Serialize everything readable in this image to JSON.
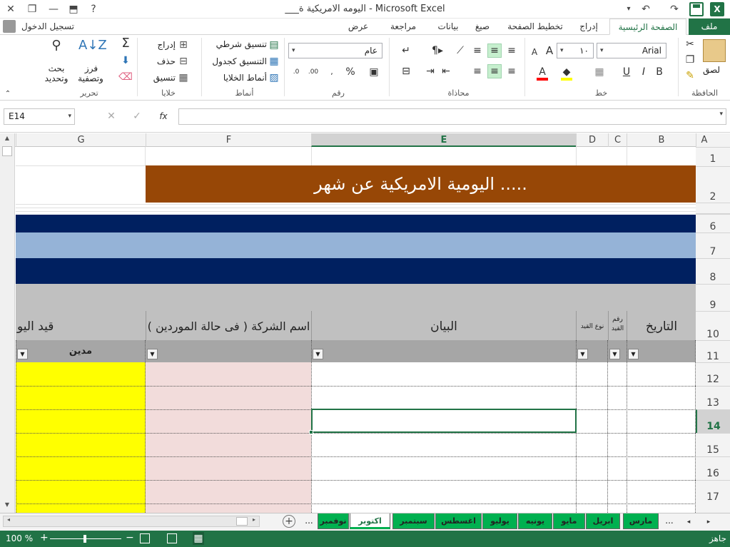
{
  "window": {
    "title": "___اليومه الامريكية ة - Microsoft Excel"
  },
  "tabs": {
    "file": "ملف",
    "home": "الصفحة الرئيسية",
    "insert": "إدراج",
    "page_layout": "تخطيط الصفحة",
    "formulas": "صيغ",
    "data": "بيانات",
    "review": "مراجعة",
    "view": "عرض"
  },
  "signin": {
    "label": "تسجيل الدخول"
  },
  "ribbon": {
    "clipboard": {
      "group": "الحافظة",
      "paste": "لصق"
    },
    "font": {
      "group": "خط",
      "name": "Arial",
      "size": "١٠",
      "bold": "B",
      "italic": "I",
      "underline": "U",
      "grow": "A",
      "shrink": "A"
    },
    "alignment": {
      "group": "محاذاة"
    },
    "number": {
      "group": "رقم",
      "format": "عام",
      "percent": "%"
    },
    "styles": {
      "group": "أنماط",
      "conditional": "تنسيق شرطي",
      "as_table": "التنسيق كجدول",
      "cell_styles": "أنماط الخلايا"
    },
    "cells": {
      "group": "خلايا",
      "insert": "إدراج",
      "delete": "حذف",
      "format": "تنسيق"
    },
    "editing": {
      "group": "تحرير",
      "sort": "فرز",
      "sort2": "وتصفية",
      "find": "بحث",
      "find2": "وتحديد"
    }
  },
  "formula_bar": {
    "name_box": "E14",
    "value": "",
    "fx": "fx"
  },
  "columns": [
    "A",
    "B",
    "C",
    "D",
    "E",
    "F",
    "G"
  ],
  "rows": [
    "1",
    "2",
    "6",
    "7",
    "8",
    "9",
    "10",
    "11",
    "12",
    "13",
    "14",
    "15",
    "16",
    "17"
  ],
  "sheet": {
    "title": "اليومية الامريكية عن شهر .....",
    "headers": {
      "date": "التاريخ",
      "entry_no": "رقم",
      "entry_no2": "القيد",
      "entry_type": "نوع القيد",
      "statement": "البيان",
      "company": "اسم الشركة ( فى حالة الموردين )",
      "journal": "قيد اليو",
      "debit": "مدين"
    }
  },
  "sheet_tabs": [
    "مارس",
    "ابريل",
    "مايو",
    "يونيه",
    "يوليو",
    "اغسطس",
    "سبتمبر",
    "اكتوبر",
    "نوفمبر"
  ],
  "sheet_nav": {
    "more_left": "...",
    "more_right": "..."
  },
  "status": {
    "ready": "جاهز",
    "zoom": "100 %"
  },
  "colors": {
    "brand": "#217346",
    "title_band": "#974706",
    "navy": "#002060",
    "light_blue": "#95b3d7",
    "gray": "#c0c0c0",
    "yellow": "#ffff00",
    "pink": "#f2dcdb",
    "tab_green": "#00b050"
  }
}
